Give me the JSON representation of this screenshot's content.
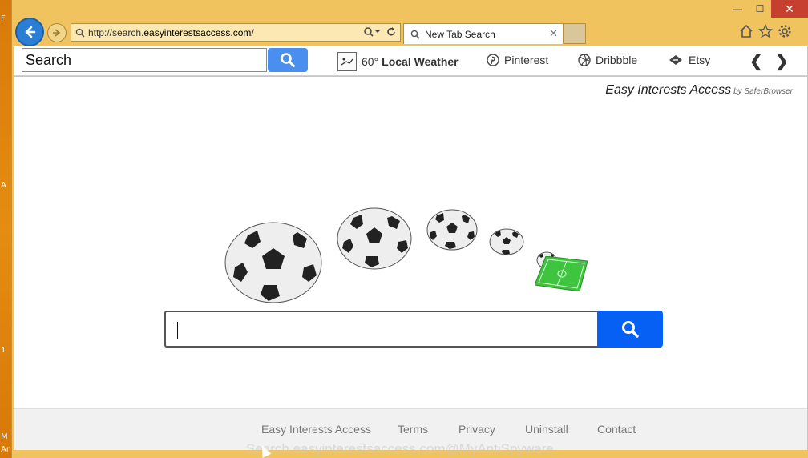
{
  "desktop": {
    "glyphs": [
      "F",
      "A",
      "1",
      "M",
      "Ar"
    ]
  },
  "window": {
    "controls": {
      "minimize": "—",
      "maximize": "☐",
      "close": "✕"
    }
  },
  "address_bar": {
    "url_prefix": "http://search.",
    "url_domain": "easyinterestsaccess.com",
    "url_suffix": "/"
  },
  "tab": {
    "title": "New Tab Search",
    "close": "✕"
  },
  "toolbar": {
    "search_value": "Search",
    "weather": {
      "temp": "60°",
      "label": "Local Weather"
    },
    "links": [
      "Pinterest",
      "Dribbble",
      "Etsy"
    ],
    "prev": "❮",
    "next": "❯"
  },
  "page": {
    "brand": "Easy Interests Access",
    "brand_by": "by SaferBrowser"
  },
  "footer": {
    "links": [
      "Easy Interests Access",
      "Terms",
      "Privacy",
      "Uninstall",
      "Contact"
    ],
    "watermark": "Search.easyinterestsaccess.com@MyAntiSpyware"
  },
  "colors": {
    "accent": "#0760f4",
    "toolbar_button": "#4a8ef0",
    "window_frame": "#f1c35e",
    "close_button": "#c7402f"
  }
}
